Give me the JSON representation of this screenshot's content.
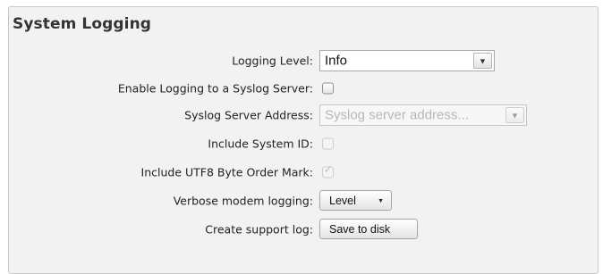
{
  "section": {
    "title": "System Logging"
  },
  "fields": {
    "logging_level": {
      "label": "Logging Level:",
      "value": "Info"
    },
    "enable_syslog": {
      "label": "Enable Logging to a Syslog Server:",
      "checked": false
    },
    "syslog_address": {
      "label": "Syslog Server Address:",
      "placeholder": "Syslog server address..."
    },
    "include_system_id": {
      "label": "Include System ID:",
      "checked": false,
      "disabled": true
    },
    "include_utf8_bom": {
      "label": "Include UTF8 Byte Order Mark:",
      "checked": true,
      "disabled": true
    },
    "verbose_modem_logging": {
      "label": "Verbose modem logging:",
      "button_label": "Level"
    },
    "support_log": {
      "label": "Create support log:",
      "button_label": "Save to disk"
    }
  },
  "icons": {
    "dropdown_arrow": "chevron-down-icon",
    "dropdown_caret": "caret-down-icon",
    "checkmark": "checkmark-icon"
  }
}
